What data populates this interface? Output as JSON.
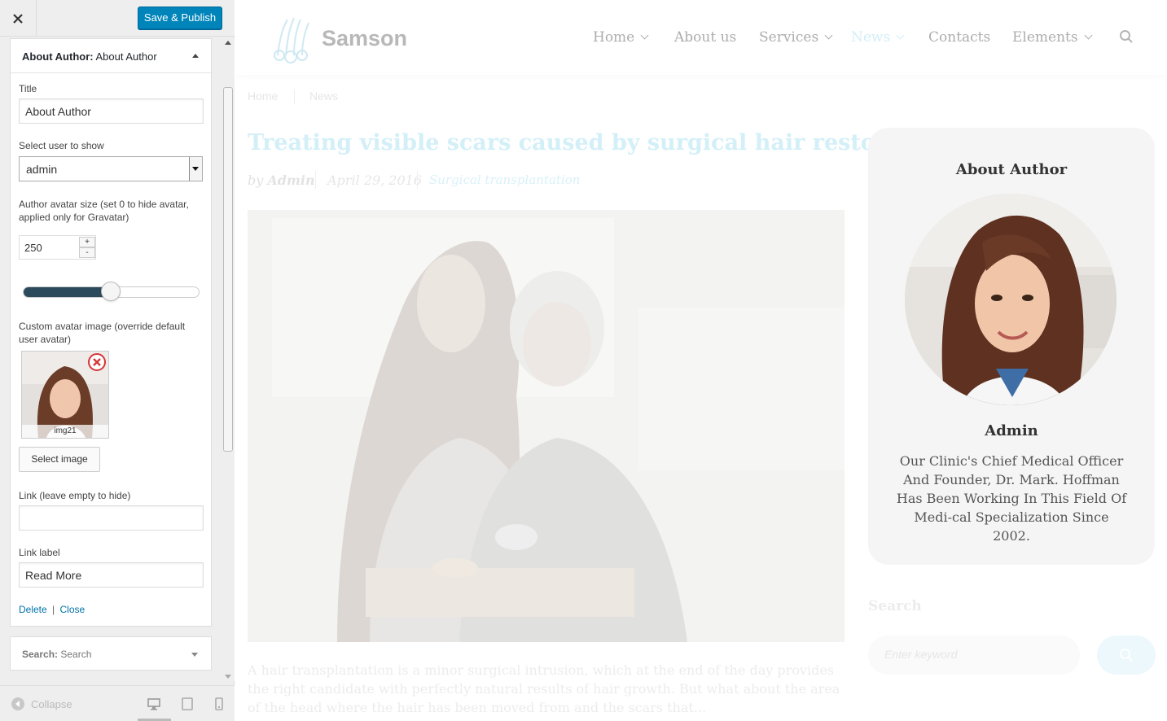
{
  "customizer": {
    "close_label": "×",
    "save_label": "Save & Publish",
    "widget": {
      "title_prefix": "About Author:",
      "title_name": "About Author",
      "fields": {
        "title_label": "Title",
        "title_value": "About Author",
        "user_label": "Select user to show",
        "user_value": "admin",
        "avatar_size_label": "Author avatar size (set 0 to hide avatar, applied only for Gravatar)",
        "avatar_size_value": "250",
        "avatar_size_fraction": 0.5,
        "spin_up": "+",
        "spin_down": "-",
        "custom_avatar_label": "Custom avatar image (override default user avatar)",
        "avatar_caption": "img21",
        "select_image_label": "Select image",
        "link_label": "Link (leave empty to hide)",
        "link_value": "",
        "link_text_label": "Link label",
        "link_text_value": "Read More"
      },
      "actions": {
        "delete": "Delete",
        "separator": "|",
        "close": "Close"
      }
    },
    "search_widget": {
      "prefix": "Search:",
      "name": "Search"
    },
    "footer": {
      "collapse_label": "Collapse",
      "devices": [
        "desktop-icon",
        "tablet-icon",
        "mobile-icon"
      ]
    },
    "colors": {
      "primary": "#0085ba",
      "slider_fill": "#2b4a5b",
      "link": "#0073aa",
      "remove": "#d63638"
    }
  },
  "site": {
    "logo": "Samson",
    "nav": [
      {
        "label": "Home",
        "dropdown": true,
        "active": false
      },
      {
        "label": "About us",
        "dropdown": false,
        "active": false
      },
      {
        "label": "Services",
        "dropdown": true,
        "active": false
      },
      {
        "label": "News",
        "dropdown": true,
        "active": true
      },
      {
        "label": "Contacts",
        "dropdown": false,
        "active": false
      },
      {
        "label": "Elements",
        "dropdown": true,
        "active": false
      }
    ],
    "breadcrumb": [
      "Home",
      "News"
    ],
    "post": {
      "title": "Treating visible scars caused by surgical hair restoration",
      "by": "by",
      "author": "Admin",
      "date": "April 29, 2016",
      "category": "Surgical transplantation",
      "excerpt": "A hair transplantation is a minor surgical intrusion, which at the end of the day provides the right candidate with perfectly natural results of hair growth. But what about the area of the head where the hair has been moved from and the scars that..."
    },
    "author_widget": {
      "title": "About Author",
      "name": "Admin",
      "bio": "Our Clinic's Chief Medical Officer And Founder, Dr. Mark. Hoffman Has Been Working In This Field Of Medi-cal Specialization Since 2002."
    },
    "search_widget": {
      "heading": "Search",
      "placeholder": "Enter keyword"
    },
    "colors": {
      "accent": "#5bc0de",
      "card_bg": "#f5f5f5"
    }
  }
}
